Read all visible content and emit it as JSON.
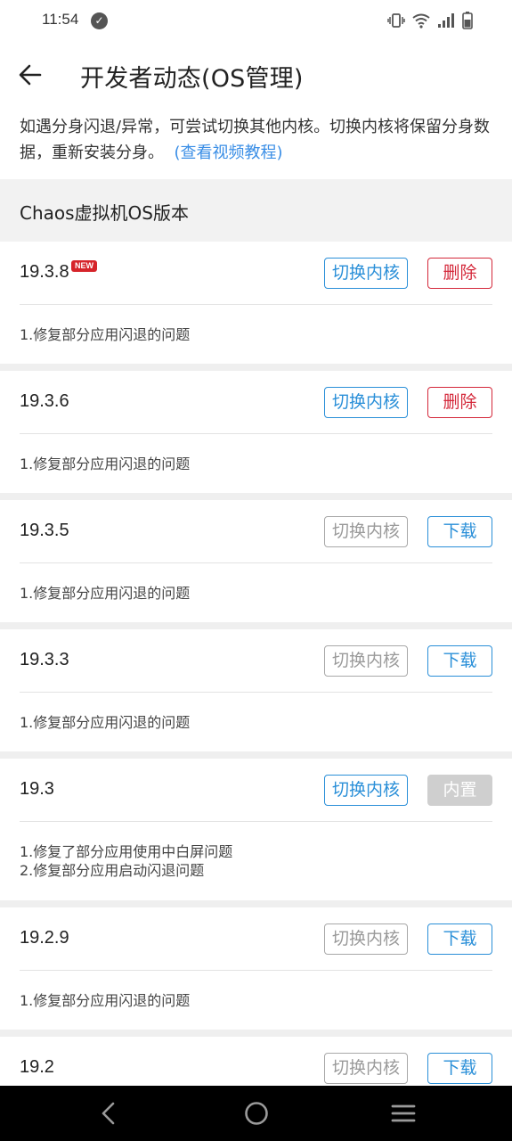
{
  "status_bar": {
    "time": "11:54",
    "icons": [
      "check-circle-icon",
      "vibrate-icon",
      "wifi-icon",
      "signal-icon",
      "battery-icon"
    ]
  },
  "app_bar": {
    "title": "开发者动态(OS管理)",
    "back_icon": "arrow-left-icon"
  },
  "notice": {
    "text": "如遇分身闪退/异常，可尝试切换其他内核。切换内核将保留分身数据，重新安装分身。",
    "link": "(查看视频教程)"
  },
  "section": {
    "title": "Chaos虚拟机OS版本"
  },
  "versions": [
    {
      "version": "19.3.8",
      "badge": "NEW",
      "switch_label": "切换内核",
      "switch_enabled": true,
      "action_label": "删除",
      "action_type": "delete",
      "notes": [
        "1.修复部分应用闪退的问题"
      ]
    },
    {
      "version": "19.3.6",
      "badge": "",
      "switch_label": "切换内核",
      "switch_enabled": true,
      "action_label": "删除",
      "action_type": "delete",
      "notes": [
        "1.修复部分应用闪退的问题"
      ]
    },
    {
      "version": "19.3.5",
      "badge": "",
      "switch_label": "切换内核",
      "switch_enabled": false,
      "action_label": "下载",
      "action_type": "download",
      "notes": [
        "1.修复部分应用闪退的问题"
      ]
    },
    {
      "version": "19.3.3",
      "badge": "",
      "switch_label": "切换内核",
      "switch_enabled": false,
      "action_label": "下载",
      "action_type": "download",
      "notes": [
        "1.修复部分应用闪退的问题"
      ]
    },
    {
      "version": "19.3",
      "badge": "",
      "switch_label": "切换内核",
      "switch_enabled": true,
      "action_label": "内置",
      "action_type": "builtin",
      "notes": [
        "1.修复了部分应用使用中白屏问题",
        "2.修复部分应用启动闪退问题"
      ]
    },
    {
      "version": "19.2.9",
      "badge": "",
      "switch_label": "切换内核",
      "switch_enabled": false,
      "action_label": "下载",
      "action_type": "download",
      "notes": [
        "1.修复部分应用闪退的问题"
      ]
    },
    {
      "version": "19.2",
      "badge": "",
      "switch_label": "切换内核",
      "switch_enabled": false,
      "action_label": "下载",
      "action_type": "download",
      "notes": []
    }
  ],
  "nav_bar": {
    "icons": [
      "nav-back-icon",
      "nav-home-icon",
      "nav-menu-icon"
    ]
  },
  "colors": {
    "accent_blue": "#2a8fd8",
    "delete_red": "#d4283a",
    "badge_red": "#d6242a",
    "section_bg": "#f2f2f2"
  }
}
